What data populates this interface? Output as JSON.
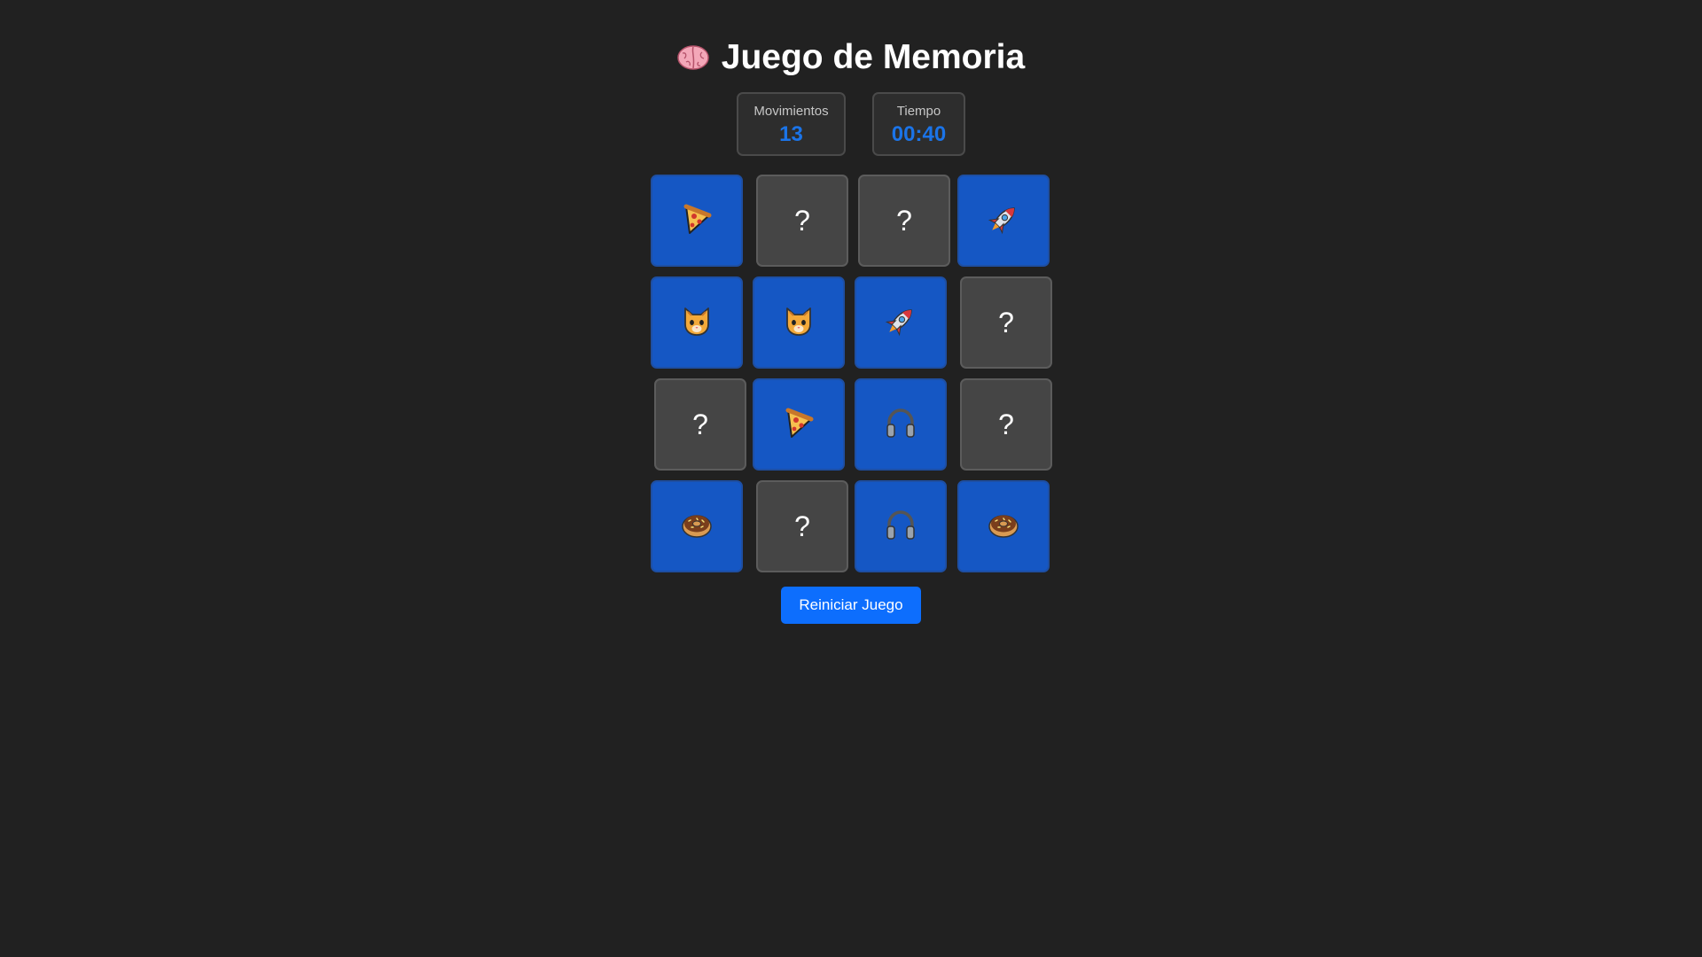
{
  "header": {
    "title": "Juego de Memoria",
    "icon": "brain-icon"
  },
  "stats": {
    "moves_label": "Movimientos",
    "moves_value": "13",
    "time_label": "Tiempo",
    "time_value": "00:40"
  },
  "colors": {
    "background": "#212121",
    "card_hidden": "#454545",
    "card_revealed": "#1557c4",
    "accent": "#0d6efd",
    "stat_value": "#1b74e8"
  },
  "board": {
    "rows": 4,
    "cols": 4,
    "hidden_symbol": "?",
    "cards": [
      {
        "state": "revealed",
        "icon": "pizza-icon"
      },
      {
        "state": "hidden",
        "icon": ""
      },
      {
        "state": "hidden",
        "icon": ""
      },
      {
        "state": "revealed",
        "icon": "rocket-icon"
      },
      {
        "state": "revealed",
        "icon": "cat-icon"
      },
      {
        "state": "revealed",
        "icon": "cat-icon"
      },
      {
        "state": "revealed",
        "icon": "rocket-icon"
      },
      {
        "state": "hidden",
        "icon": ""
      },
      {
        "state": "hidden",
        "icon": ""
      },
      {
        "state": "revealed",
        "icon": "pizza-icon"
      },
      {
        "state": "revealed",
        "icon": "headphones-icon"
      },
      {
        "state": "hidden",
        "icon": ""
      },
      {
        "state": "revealed",
        "icon": "donut-icon"
      },
      {
        "state": "hidden",
        "icon": ""
      },
      {
        "state": "revealed",
        "icon": "headphones-icon"
      },
      {
        "state": "revealed",
        "icon": "donut-icon"
      }
    ]
  },
  "actions": {
    "restart_label": "Reiniciar Juego"
  }
}
